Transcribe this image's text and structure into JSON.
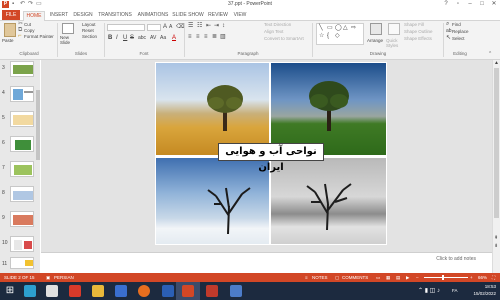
{
  "app": {
    "window_title": "37.ppt - PowerPoint",
    "file_tab": "FILE",
    "app_badge": "P"
  },
  "tabs": [
    "HOME",
    "INSERT",
    "DESIGN",
    "TRANSITIONS",
    "ANIMATIONS",
    "SLIDE SHOW",
    "REVIEW",
    "VIEW"
  ],
  "active_tab": "HOME",
  "ribbon": {
    "clipboard": {
      "paste": "Paste",
      "cut": "Cut",
      "copy": "Copy",
      "format_painter": "Format Painter",
      "label": "Clipboard"
    },
    "slides": {
      "new_slide": "New Slide",
      "layout": "Layout",
      "reset": "Reset",
      "section": "Section",
      "label": "Slides"
    },
    "font": {
      "bold": "B",
      "italic": "I",
      "underline": "U",
      "strike": "S",
      "shadow": "abc",
      "spacing": "AV",
      "case": "Aa",
      "color": "A",
      "label": "Font"
    },
    "paragraph": {
      "text_direction": "Text Direction",
      "align_text": "Align Text",
      "convert_smartart": "Convert to SmartArt",
      "label": "Paragraph"
    },
    "drawing": {
      "arrange": "Arrange",
      "quick_styles": "Quick Styles",
      "shape_fill": "Shape Fill",
      "shape_outline": "Shape Outline",
      "shape_effects": "Shape Effects",
      "label": "Drawing"
    },
    "editing": {
      "find": "Find",
      "replace": "Replace",
      "select": "Select",
      "label": "Editing"
    }
  },
  "thumbnails": [
    {
      "number": "3"
    },
    {
      "number": "4"
    },
    {
      "number": "5"
    },
    {
      "number": "6"
    },
    {
      "number": "7"
    },
    {
      "number": "8"
    },
    {
      "number": "9"
    },
    {
      "number": "10"
    },
    {
      "number": "11"
    }
  ],
  "slide": {
    "title": "نواحی آب و هوایی ایران"
  },
  "notes_placeholder": "Click to add notes",
  "status": {
    "slide_info": "SLIDE 2 OF 15",
    "language": "PERSIAN",
    "notes": "NOTES",
    "comments": "COMMENTS",
    "zoom": "66%"
  },
  "taskbar": {
    "language": "FA",
    "time": "18:53",
    "date": "15/02/2022"
  },
  "colors": {
    "accent": "#d24726",
    "ribbon_bg": "#f3f3f3",
    "taskbar": "#1c2a3f"
  }
}
